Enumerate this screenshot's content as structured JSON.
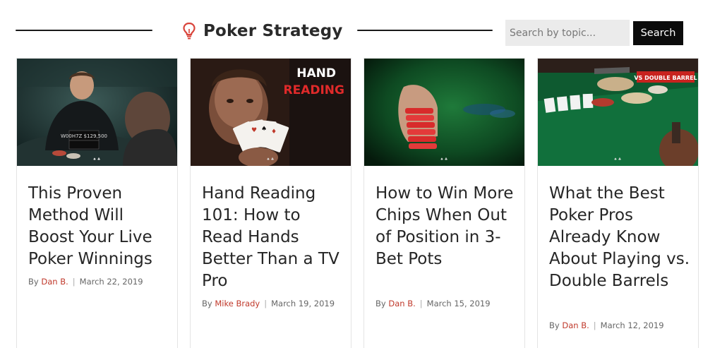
{
  "header": {
    "title": "Poker Strategy",
    "icon": "lightbulb-icon",
    "accent_color": "#d9443b"
  },
  "search": {
    "placeholder": "Search by topic...",
    "button_label": "Search"
  },
  "cards": [
    {
      "image": "poker-player-at-table-photo",
      "image_text": "W00H7Z $129,500",
      "title": "This Proven Method Will Boost Your Live Poker Winnings",
      "by": "By",
      "author": "Dan B.",
      "separator": "|",
      "date": "March 22, 2019"
    },
    {
      "image": "hand-reading-photo",
      "image_text_line1": "HAND",
      "image_text_line2": "READING",
      "title": "Hand Reading 101: How to Read Hands Better Than a TV Pro",
      "by": "By",
      "author": "Mike Brady",
      "separator": "|",
      "date": "March 19, 2019"
    },
    {
      "image": "chip-stack-photo",
      "title": "How to Win More Chips When Out of Position in 3-Bet Pots",
      "by": "By",
      "author": "Dan B.",
      "separator": "|",
      "date": "March 15, 2019"
    },
    {
      "image": "double-barrel-table-photo",
      "image_text": "VS DOUBLE BARREL",
      "title": "What the Best Poker Pros Already Know About Playing vs. Double Barrels",
      "by": "By",
      "author": "Dan B.",
      "separator": "|",
      "date": "March 12, 2019"
    }
  ],
  "colors": {
    "author_link": "#c0392b",
    "button_bg": "#0b0b0b",
    "search_bg": "#ebebeb"
  }
}
